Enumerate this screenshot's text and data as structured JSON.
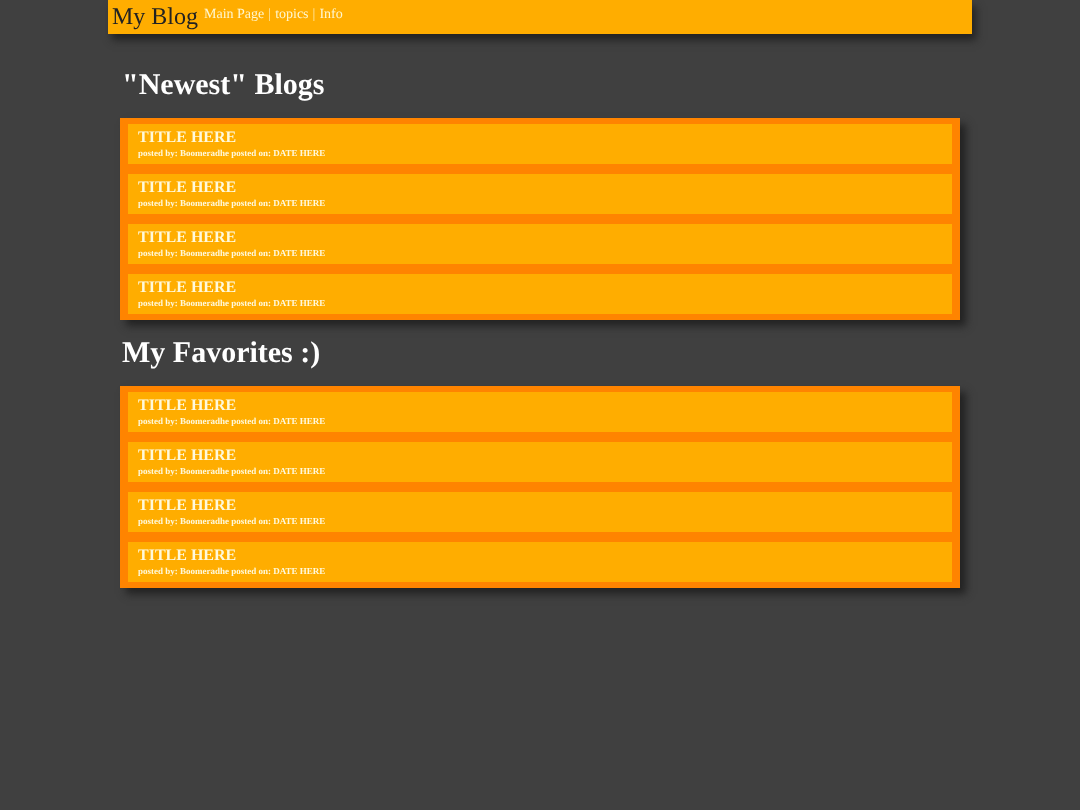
{
  "header": {
    "title": "My Blog",
    "nav": [
      {
        "kind": "link",
        "text": "Main Page"
      },
      {
        "kind": "separator",
        "text": "|"
      },
      {
        "kind": "link",
        "text": "topics"
      },
      {
        "kind": "separator",
        "text": "|"
      },
      {
        "kind": "link",
        "text": "Info"
      }
    ]
  },
  "sections": [
    {
      "heading": "\"Newest\" Blogs",
      "posts": [
        {
          "title": "TITLE HERE",
          "meta": "posted by: Boomeradhe posted on: DATE HERE"
        },
        {
          "title": "TITLE HERE",
          "meta": "posted by: Boomeradhe posted on: DATE HERE"
        },
        {
          "title": "TITLE HERE",
          "meta": "posted by: Boomeradhe posted on: DATE HERE"
        },
        {
          "title": "TITLE HERE",
          "meta": "posted by: Boomeradhe posted on: DATE HERE"
        }
      ]
    },
    {
      "heading": "My Favorites :)",
      "posts": [
        {
          "title": "TITLE HERE",
          "meta": "posted by: Boomeradhe posted on: DATE HERE"
        },
        {
          "title": "TITLE HERE",
          "meta": "posted by: Boomeradhe posted on: DATE HERE"
        },
        {
          "title": "TITLE HERE",
          "meta": "posted by: Boomeradhe posted on: DATE HERE"
        },
        {
          "title": "TITLE HERE",
          "meta": "posted by: Boomeradhe posted on: DATE HERE"
        }
      ]
    }
  ]
}
